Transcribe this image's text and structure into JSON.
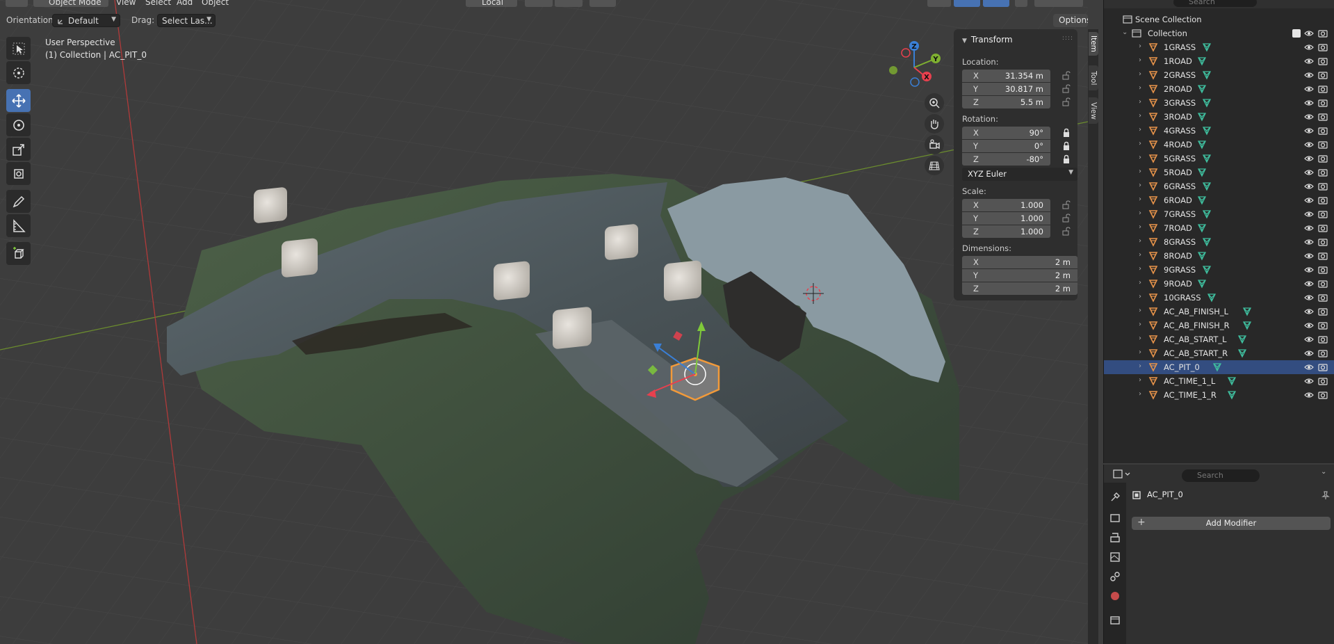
{
  "header": {
    "mode": "Object Mode",
    "menus": [
      "View",
      "Select",
      "Add",
      "Object"
    ],
    "transform_orientation": "Local"
  },
  "toolsettings": {
    "orientation_label": "Orientation:",
    "orientation_value": "Default",
    "drag_label": "Drag:",
    "drag_value": "Select Las...",
    "options_label": "Options"
  },
  "viewport": {
    "view_name": "User Perspective",
    "collection_info": "(1) Collection | AC_PIT_0",
    "gizmo_axes": {
      "x": "X",
      "y": "Y",
      "z": "Z"
    }
  },
  "toolbar": {
    "tools": [
      "select-box",
      "cursor",
      "move",
      "rotate",
      "scale",
      "transform",
      "annotate",
      "measure",
      "add-cube"
    ],
    "active": "move"
  },
  "transform_panel": {
    "title": "Transform",
    "location_label": "Location:",
    "location": [
      {
        "axis": "X",
        "value": "31.354 m"
      },
      {
        "axis": "Y",
        "value": "30.817 m"
      },
      {
        "axis": "Z",
        "value": "5.5 m"
      }
    ],
    "rotation_label": "Rotation:",
    "rotation": [
      {
        "axis": "X",
        "value": "90°"
      },
      {
        "axis": "Y",
        "value": "0°"
      },
      {
        "axis": "Z",
        "value": "-80°"
      }
    ],
    "rotation_mode": "XYZ Euler",
    "scale_label": "Scale:",
    "scale": [
      {
        "axis": "X",
        "value": "1.000"
      },
      {
        "axis": "Y",
        "value": "1.000"
      },
      {
        "axis": "Z",
        "value": "1.000"
      }
    ],
    "dimensions_label": "Dimensions:",
    "dimensions": [
      {
        "axis": "X",
        "value": "2 m"
      },
      {
        "axis": "Y",
        "value": "2 m"
      },
      {
        "axis": "Z",
        "value": "2 m"
      }
    ]
  },
  "npanel_tabs": [
    "Item",
    "Tool",
    "View"
  ],
  "outliner": {
    "search_placeholder": "Search",
    "scene_collection": "Scene Collection",
    "collection": "Collection",
    "objects": [
      "1GRASS",
      "1ROAD",
      "2GRASS",
      "2ROAD",
      "3GRASS",
      "3ROAD",
      "4GRASS",
      "4ROAD",
      "5GRASS",
      "5ROAD",
      "6GRASS",
      "6ROAD",
      "7GRASS",
      "7ROAD",
      "8GRASS",
      "8ROAD",
      "9GRASS",
      "9ROAD",
      "10GRASS",
      "AC_AB_FINISH_L",
      "AC_AB_FINISH_R",
      "AC_AB_START_L",
      "AC_AB_START_R",
      "AC_PIT_0",
      "AC_TIME_1_L",
      "AC_TIME_1_R"
    ],
    "selected": "AC_PIT_0"
  },
  "properties": {
    "search_placeholder": "Search",
    "object_name": "AC_PIT_0",
    "add_modifier_label": "Add Modifier"
  },
  "colors": {
    "accent": "#4772b3",
    "selected_row": "#334d80",
    "object_icon": "#e8944a",
    "mesh_icon": "#3fbf9f",
    "axis_x": "#e8404e",
    "axis_y": "#7fb030",
    "axis_z": "#3a7fd6"
  }
}
